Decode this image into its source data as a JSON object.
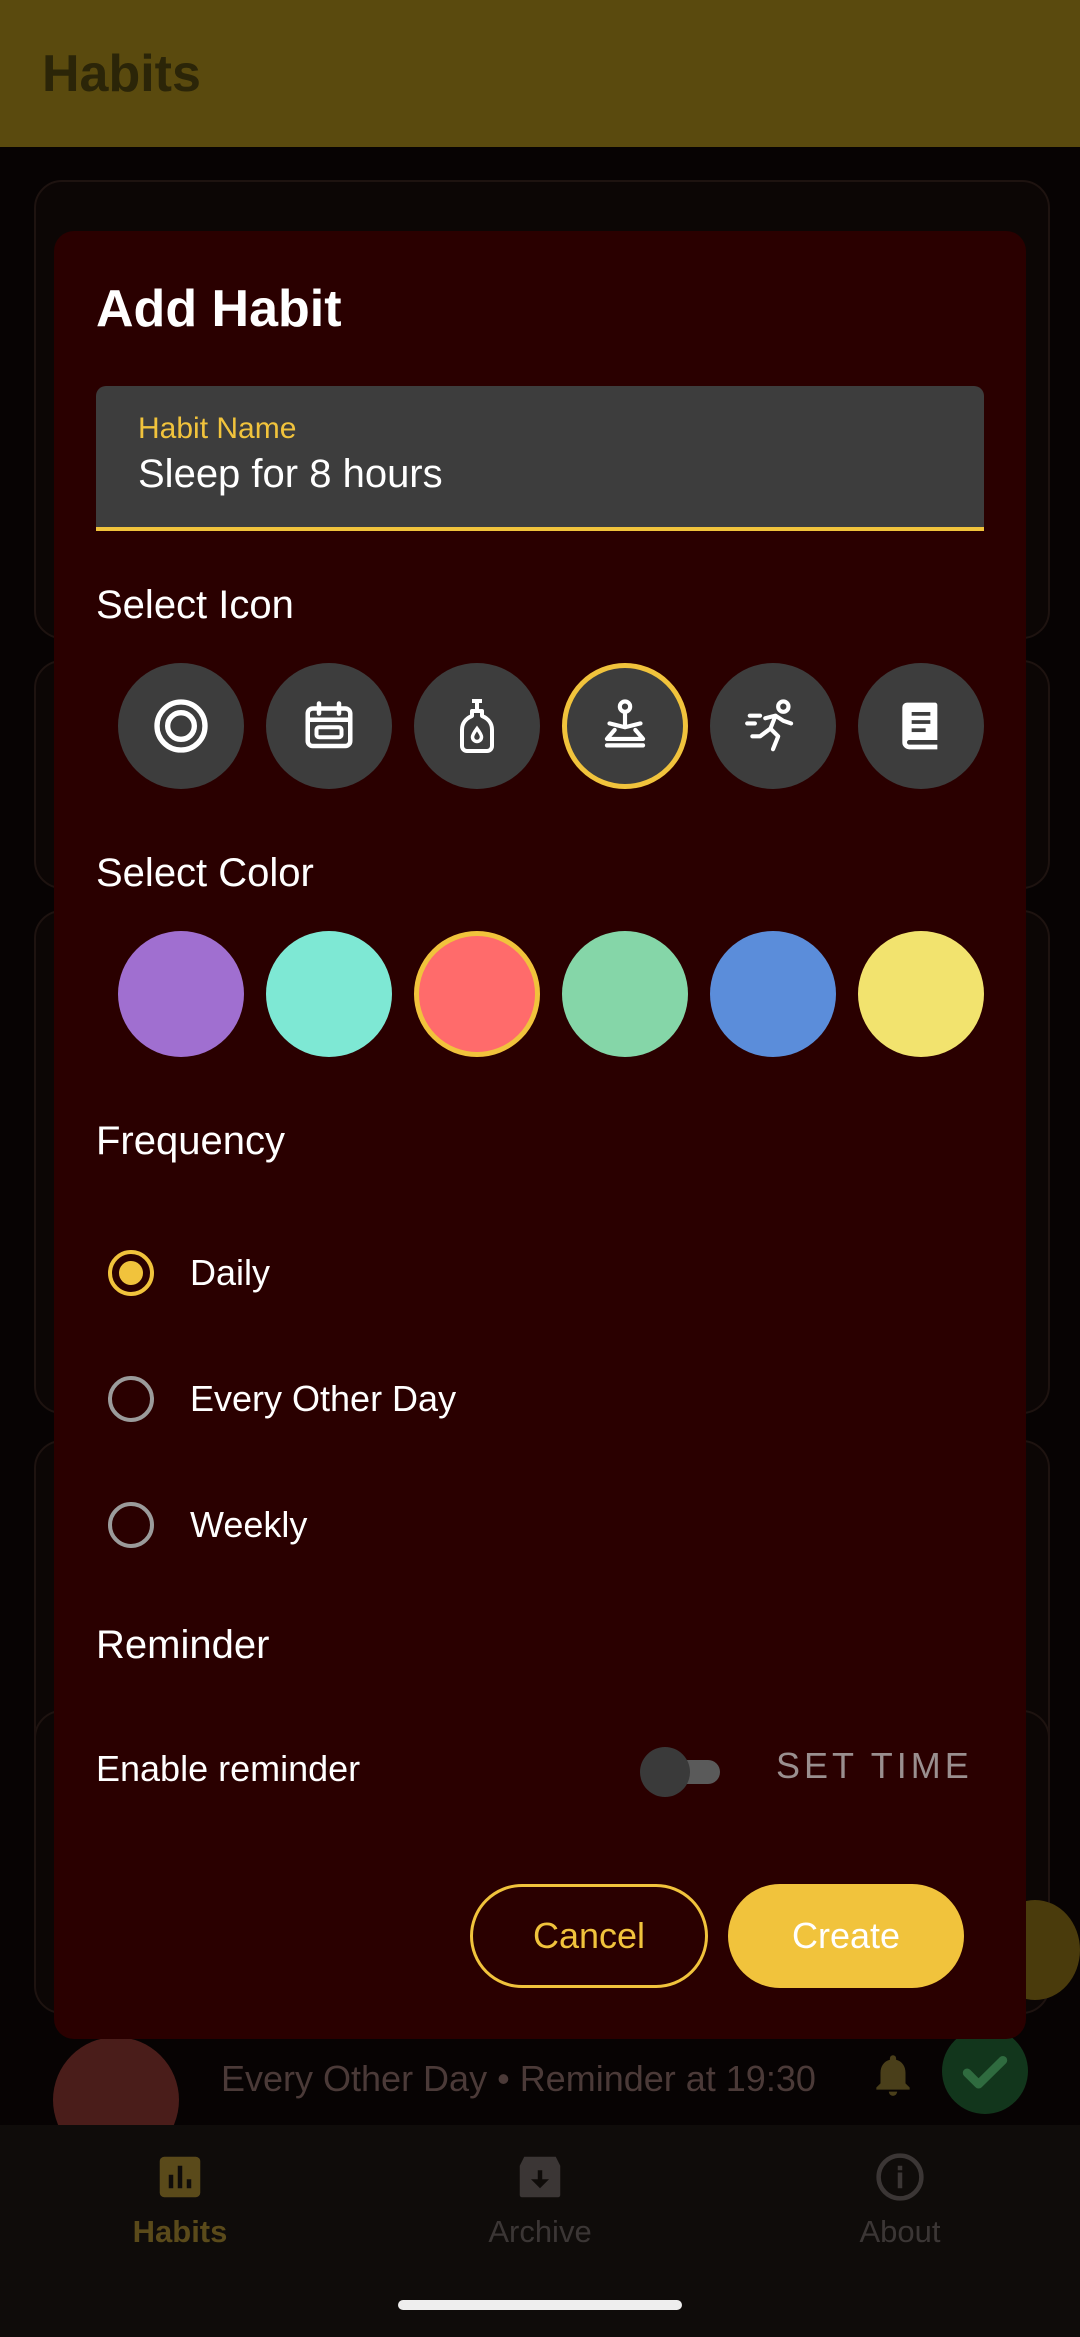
{
  "app_bar": {
    "title": "Habits"
  },
  "background_habit": {
    "subtitle": "Every Other Day • Reminder at 19:30"
  },
  "bottom_nav": [
    {
      "label": "Habits",
      "icon": "bar-chart-icon",
      "active": true
    },
    {
      "label": "Archive",
      "icon": "archive-icon",
      "active": false
    },
    {
      "label": "About",
      "icon": "info-icon",
      "active": false
    }
  ],
  "dialog": {
    "title": "Add Habit",
    "habit_name": {
      "label": "Habit Name",
      "value": "Sleep for 8 hours"
    },
    "select_icon_label": "Select Icon",
    "icons": [
      {
        "name": "target-icon",
        "selected": false
      },
      {
        "name": "calendar-icon",
        "selected": false
      },
      {
        "name": "soap-bottle-icon",
        "selected": false
      },
      {
        "name": "meditation-icon",
        "selected": true
      },
      {
        "name": "running-icon",
        "selected": false
      },
      {
        "name": "book-icon",
        "selected": false
      }
    ],
    "select_color_label": "Select Color",
    "colors": [
      {
        "hex": "#a06fd0",
        "selected": false
      },
      {
        "hex": "#7ee8d4",
        "selected": false
      },
      {
        "hex": "#ff6b6b",
        "selected": true
      },
      {
        "hex": "#85d6a8",
        "selected": false
      },
      {
        "hex": "#5b8dda",
        "selected": false
      },
      {
        "hex": "#f2e36e",
        "selected": false
      }
    ],
    "frequency_label": "Frequency",
    "frequency_options": [
      {
        "label": "Daily",
        "checked": true
      },
      {
        "label": "Every Other Day",
        "checked": false
      },
      {
        "label": "Weekly",
        "checked": false
      }
    ],
    "reminder_label": "Reminder",
    "enable_reminder_label": "Enable reminder",
    "reminder_enabled": false,
    "set_time_label": "SET TIME",
    "cancel_label": "Cancel",
    "create_label": "Create"
  },
  "accent_color": "#f1c33c",
  "dialog_background": "#2a0000"
}
